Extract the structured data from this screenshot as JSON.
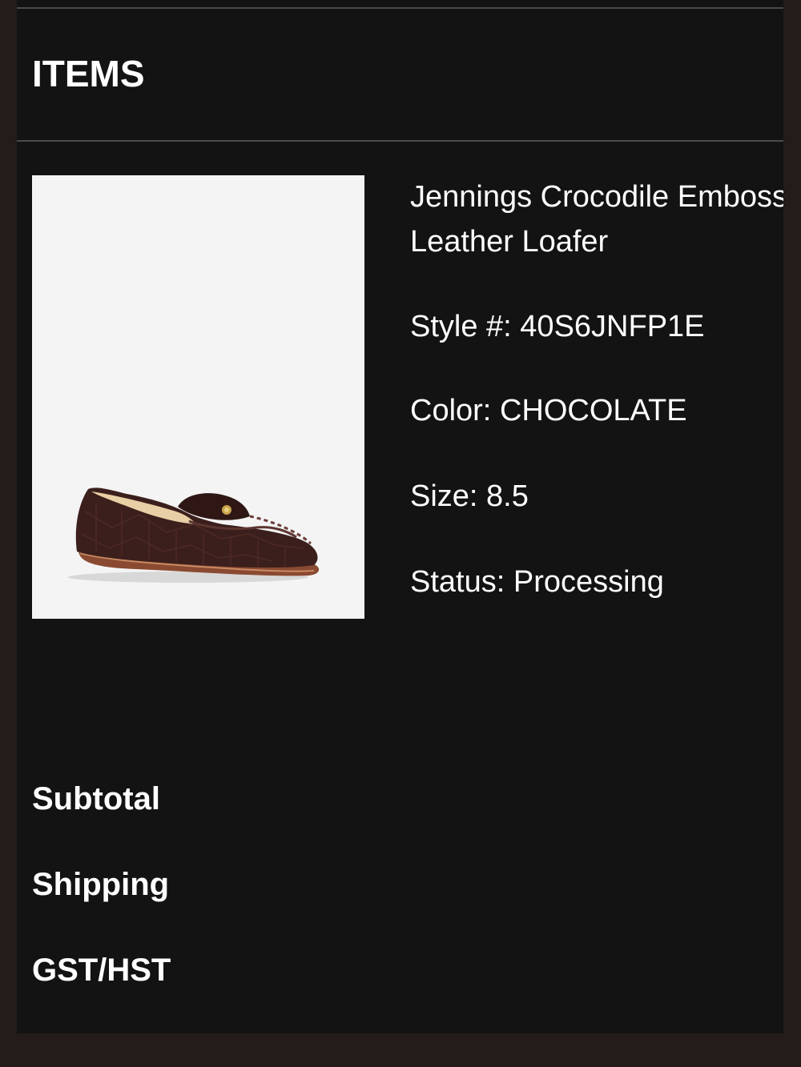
{
  "items_section": {
    "title": "ITEMS"
  },
  "item": {
    "name": "Jennings Crocodile Embossed\nLeather Loafer",
    "style_label": "Style #:",
    "style_value": "40S6JNFP1E",
    "color_label": "Color:",
    "color_value": "CHOCOLATE",
    "size_label": "Size:",
    "size_value": "8.5",
    "status_label": "Status:",
    "status_value": "Processing",
    "image_icon": "brown-crocodile-loafer-image"
  },
  "summary": {
    "subtotal_label": "Subtotal",
    "shipping_label": "Shipping",
    "tax_label": "GST/HST"
  },
  "colors": {
    "panel_background": "#131313",
    "outer_background": "#231c18",
    "text": "#ffffff",
    "divider": "#4a4a4a",
    "image_background": "#f4f4f4",
    "product_color": "#3b1f1c"
  }
}
